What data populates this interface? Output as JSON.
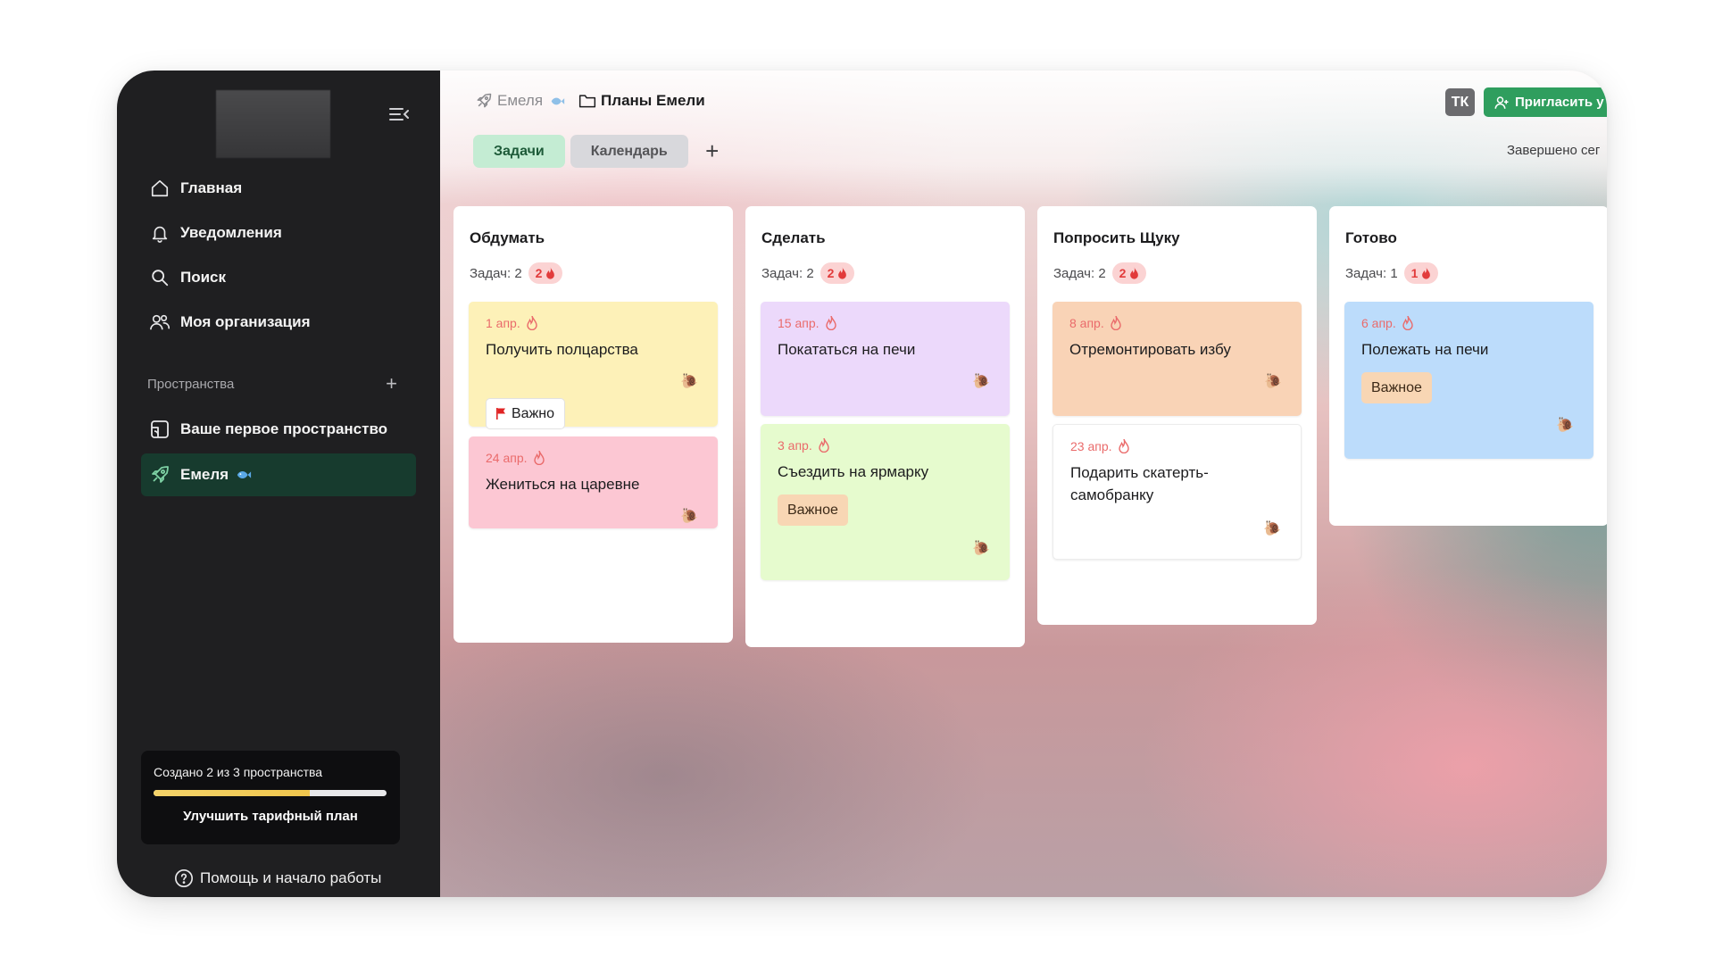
{
  "colors": {
    "sidebar_bg": "#1f1f21",
    "active_space_bg": "#173b2e",
    "accent_green": "#2f9e5e",
    "urgent_red": "#e23b3b"
  },
  "sidebar": {
    "nav": [
      {
        "label": "Главная",
        "icon": "home-icon"
      },
      {
        "label": "Уведомления",
        "icon": "bell-icon"
      },
      {
        "label": "Поиск",
        "icon": "search-icon"
      },
      {
        "label": "Моя организация",
        "icon": "users-icon"
      }
    ],
    "spaces_header": "Пространства",
    "spaces": [
      {
        "label": "Ваше первое пространство",
        "icon": "space-icon"
      },
      {
        "label": "Емеля",
        "icon": "rocket-icon",
        "badge_icon": "fish-icon"
      }
    ],
    "plan": {
      "text": "Создано 2 из 3 пространства",
      "progress": 0.67,
      "button": "Улучшить тарифный план"
    },
    "help": "Помощь и начало работы"
  },
  "header": {
    "breadcrumb_space": "Емеля",
    "breadcrumb_project": "Планы Емели",
    "avatar": "ТК",
    "invite_label": "Пригласить у",
    "status_text": "Завершено сег"
  },
  "tabs": [
    {
      "label": "Задачи"
    },
    {
      "label": "Календарь"
    }
  ],
  "columns": [
    {
      "title": "Обдумать",
      "count_label": "Задач: 2",
      "urgent": "2",
      "cards": [
        {
          "date": "1 апр.",
          "title": "Получить полцарства",
          "tag": "Важно"
        },
        {
          "date": "24 апр.",
          "title": "Жениться на царевне"
        }
      ]
    },
    {
      "title": "Сделать",
      "count_label": "Задач: 2",
      "urgent": "2",
      "cards": [
        {
          "date": "15 апр.",
          "title": "Покататься на печи"
        },
        {
          "date": "3 апр.",
          "title": "Съездить на ярмарку",
          "tag": "Важное"
        }
      ]
    },
    {
      "title": "Попросить Щуку",
      "count_label": "Задач: 2",
      "urgent": "2",
      "cards": [
        {
          "date": "8 апр.",
          "title": "Отремонтировать избу"
        },
        {
          "date": "23 апр.",
          "title": "Подарить скатерть-самобранку"
        }
      ]
    },
    {
      "title": "Готово",
      "count_label": "Задач: 1",
      "urgent": "1",
      "cards": [
        {
          "date": "6 апр.",
          "title": "Полежать на печи",
          "tag": "Важное"
        }
      ]
    }
  ]
}
